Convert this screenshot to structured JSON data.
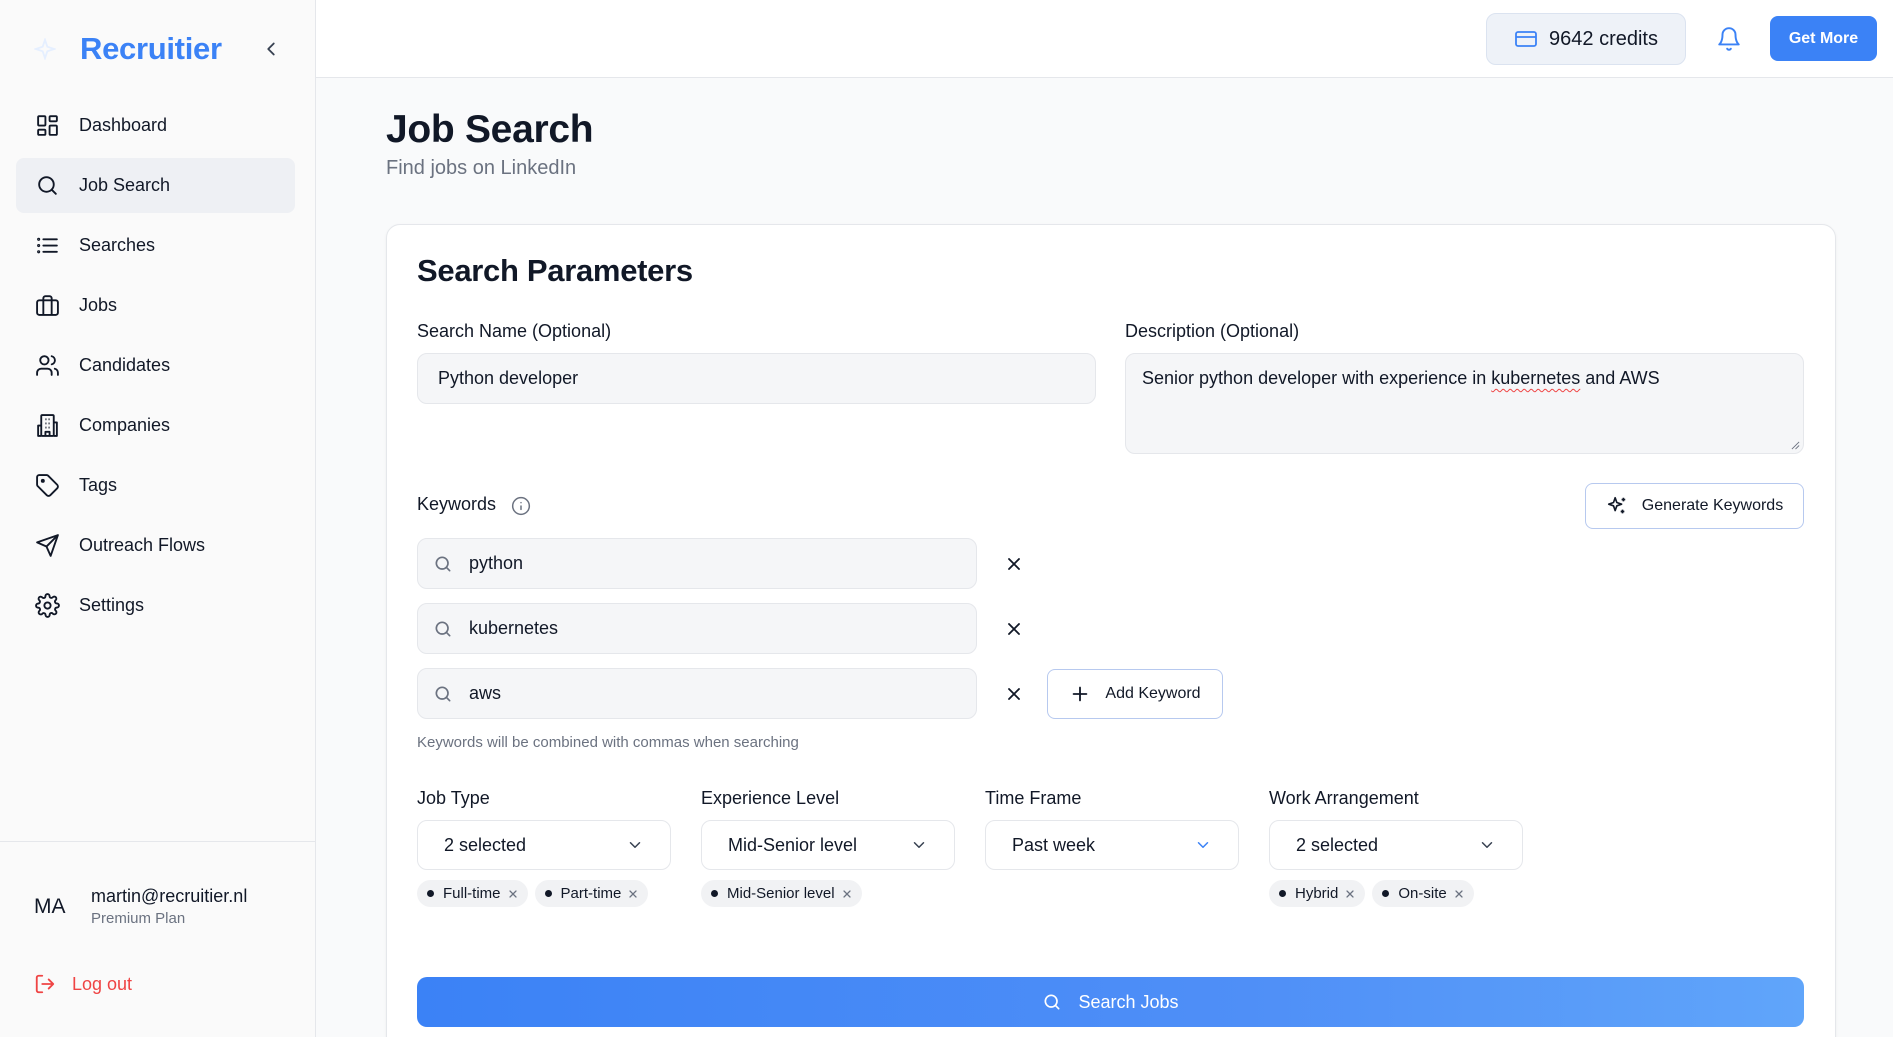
{
  "app": {
    "name": "Recruitier"
  },
  "sidebar": {
    "items": [
      {
        "label": "Dashboard",
        "icon": "dashboard-icon"
      },
      {
        "label": "Job Search",
        "icon": "search-icon",
        "active": true
      },
      {
        "label": "Searches",
        "icon": "list-icon"
      },
      {
        "label": "Jobs",
        "icon": "briefcase-icon"
      },
      {
        "label": "Candidates",
        "icon": "users-icon"
      },
      {
        "label": "Companies",
        "icon": "building-icon"
      },
      {
        "label": "Tags",
        "icon": "tag-icon"
      },
      {
        "label": "Outreach Flows",
        "icon": "send-icon"
      },
      {
        "label": "Settings",
        "icon": "gear-icon"
      }
    ],
    "user": {
      "initials": "MA",
      "email": "martin@recruitier.nl",
      "plan": "Premium Plan"
    },
    "logout_label": "Log out"
  },
  "topbar": {
    "credits": "9642 credits",
    "get_more_label": "Get More"
  },
  "page": {
    "title": "Job Search",
    "subtitle": "Find jobs on LinkedIn"
  },
  "form": {
    "title": "Search Parameters",
    "search_name": {
      "label": "Search Name (Optional)",
      "value": "Python developer"
    },
    "description": {
      "label": "Description (Optional)",
      "value_before": "Senior python developer with experience in ",
      "value_flagged": "kubernetes",
      "value_after": " and AWS"
    },
    "keywords": {
      "label": "Keywords",
      "generate_label": "Generate Keywords",
      "items": [
        "python",
        "kubernetes",
        "aws"
      ],
      "add_label": "Add Keyword",
      "hint": "Keywords will be combined with commas when searching"
    },
    "filters": [
      {
        "label": "Job Type",
        "value": "2 selected",
        "chips": [
          "Full-time",
          "Part-time"
        ]
      },
      {
        "label": "Experience Level",
        "value": "Mid-Senior level",
        "chips": [
          "Mid-Senior level"
        ]
      },
      {
        "label": "Time Frame",
        "value": "Past week",
        "chips": []
      },
      {
        "label": "Work Arrangement",
        "value": "2 selected",
        "chips": [
          "Hybrid",
          "On-site"
        ]
      }
    ],
    "submit_label": "Search Jobs"
  },
  "colors": {
    "accent": "#3b82f6",
    "danger": "#ef4444",
    "text": "#111827",
    "muted": "#6b7280"
  }
}
